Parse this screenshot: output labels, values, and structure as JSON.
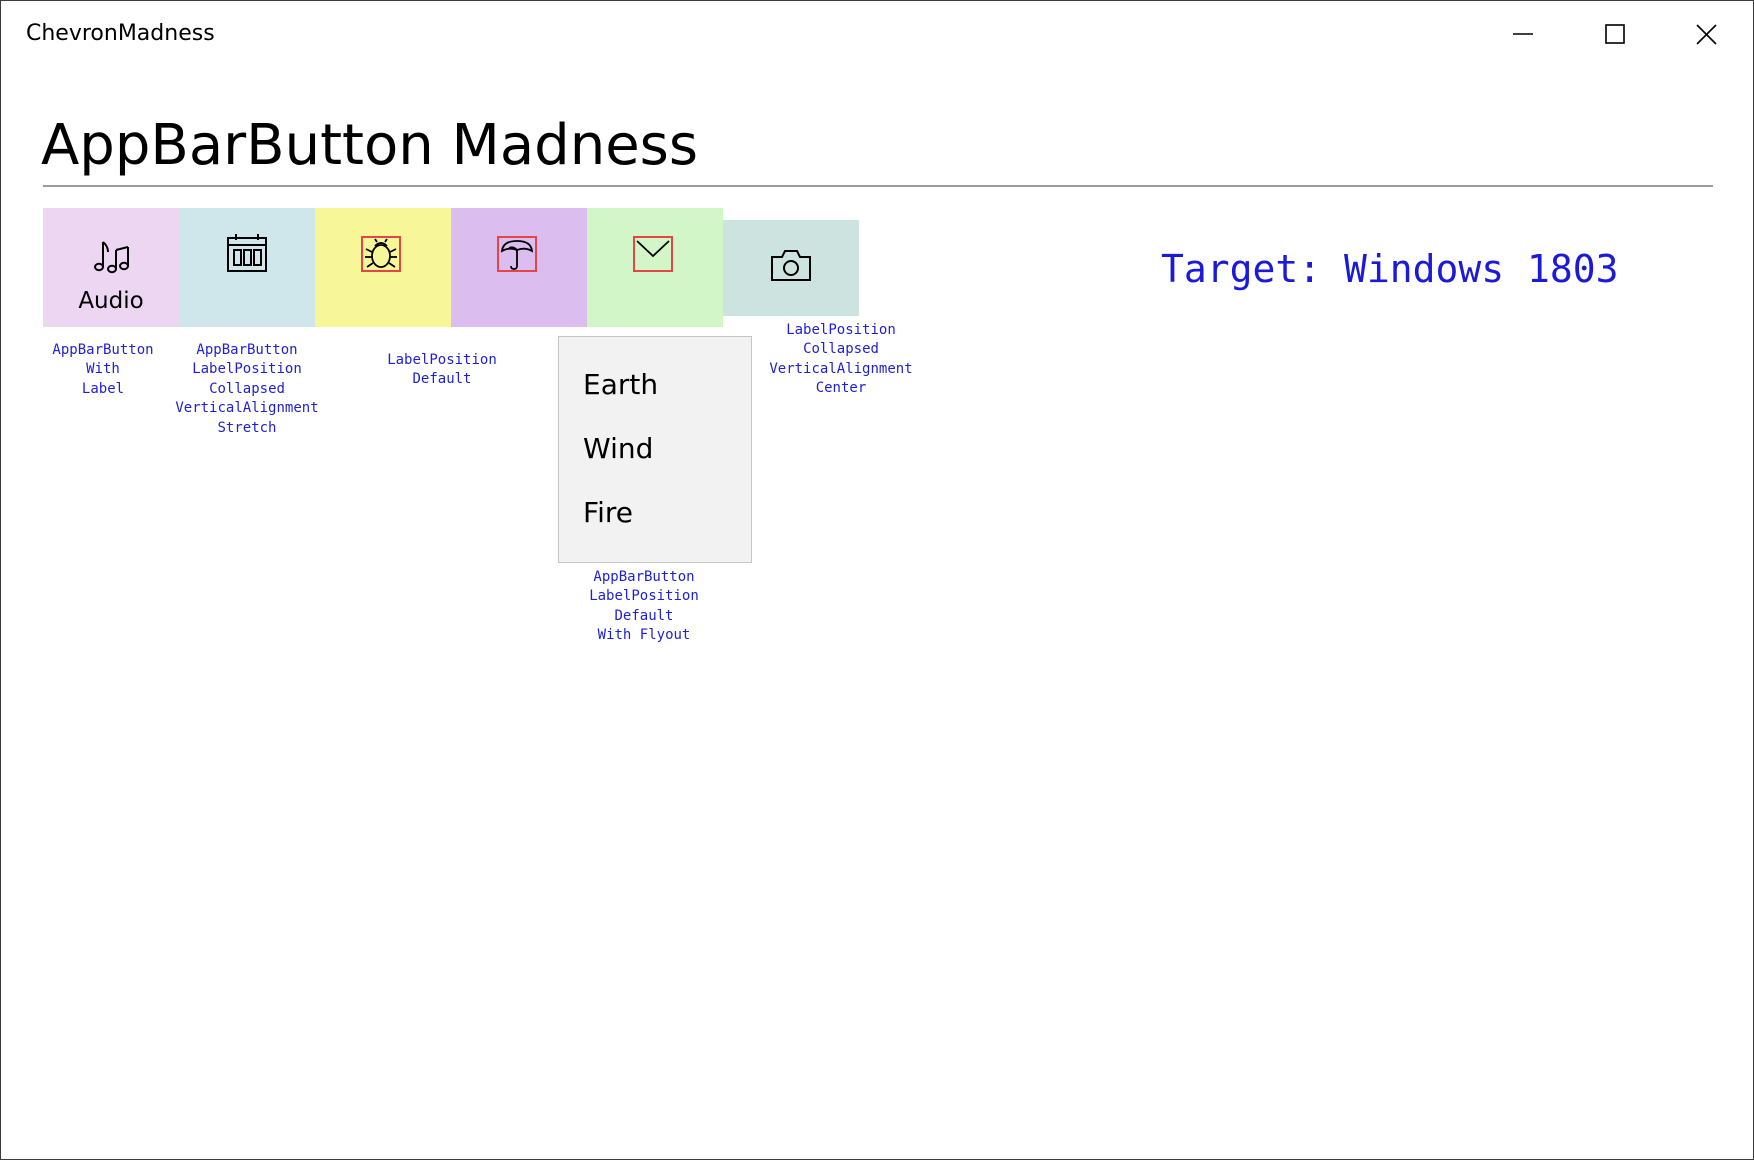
{
  "window": {
    "title": "ChevronMadness",
    "minimize_icon": "minimize-icon",
    "maximize_icon": "maximize-icon",
    "close_icon": "close-icon"
  },
  "page": {
    "title": "AppBarButton Madness",
    "target": "Target: Windows 1803"
  },
  "buttons": [
    {
      "icon": "music-notes-icon",
      "label": "Audio",
      "background": "#ecd6f2"
    },
    {
      "icon": "calendar-icon",
      "background": "#cfe7ea"
    },
    {
      "icon": "bug-icon",
      "background": "#f7f79a"
    },
    {
      "icon": "umbrella-icon",
      "background": "#dcbdf0"
    },
    {
      "icon": "mail-icon",
      "background": "#d3f6c8"
    },
    {
      "icon": "camera-icon",
      "background": "#cde3df"
    }
  ],
  "captions": {
    "audio": [
      "AppBarButton",
      "With",
      "Label"
    ],
    "calendar": [
      "AppBarButton",
      "LabelPosition",
      "Collapsed",
      "VerticalAlignment",
      "Stretch"
    ],
    "bug": [
      "LabelPosition",
      "Default"
    ],
    "mail": [
      "AppBarButton",
      "LabelPosition",
      "Default",
      "With Flyout"
    ],
    "camera": [
      "LabelPosition",
      "Collapsed",
      "VerticalAlignment",
      "Center"
    ]
  },
  "flyout": {
    "items": [
      "Earth",
      "Wind",
      "Fire"
    ]
  },
  "colors": {
    "caption_text": "#1f1fd6",
    "target_text": "#1a1ad8",
    "icon_outline_highlight": "#e64545"
  }
}
